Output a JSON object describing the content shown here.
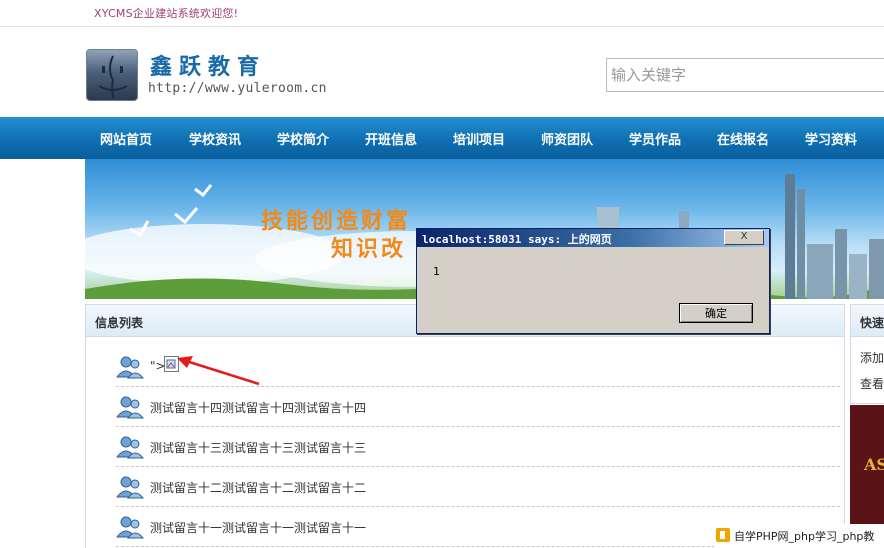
{
  "topbar": {
    "welcome": "XYCMS企业建站系统欢迎您!"
  },
  "header": {
    "brand": "鑫跃教育",
    "url": "http://www.yuleroom.cn",
    "search_placeholder": "输入关键字"
  },
  "nav": {
    "items": [
      "网站首页",
      "学校资讯",
      "学校简介",
      "开班信息",
      "培训项目",
      "师资团队",
      "学员作品",
      "在线报名",
      "学习资料"
    ]
  },
  "banner": {
    "headline_line1": "技能创造财富",
    "headline_line2": "知识改"
  },
  "info_list": {
    "title": "信息列表",
    "items": [
      {
        "text": "\">"
      },
      {
        "text": "测试留言十四测试留言十四测试留言十四"
      },
      {
        "text": "测试留言十三测试留言十三测试留言十三"
      },
      {
        "text": "测试留言十二测试留言十二测试留言十二"
      },
      {
        "text": "测试留言十一测试留言十一测试留言十一"
      }
    ]
  },
  "side_panel": {
    "title": "快速",
    "items": [
      "添加",
      "查看"
    ],
    "promo": "AS"
  },
  "dialog": {
    "title": "localhost:58031 says: 上的网页",
    "message": "1",
    "ok_label": "确定",
    "close_label": "X"
  },
  "watermark": {
    "text": "自学PHP网_php学习_php教"
  },
  "colors": {
    "nav_bg": "#0f6fb3",
    "brand": "#1a6aa8",
    "welcome": "#a0407a",
    "dialog_title": "#0a246a"
  }
}
